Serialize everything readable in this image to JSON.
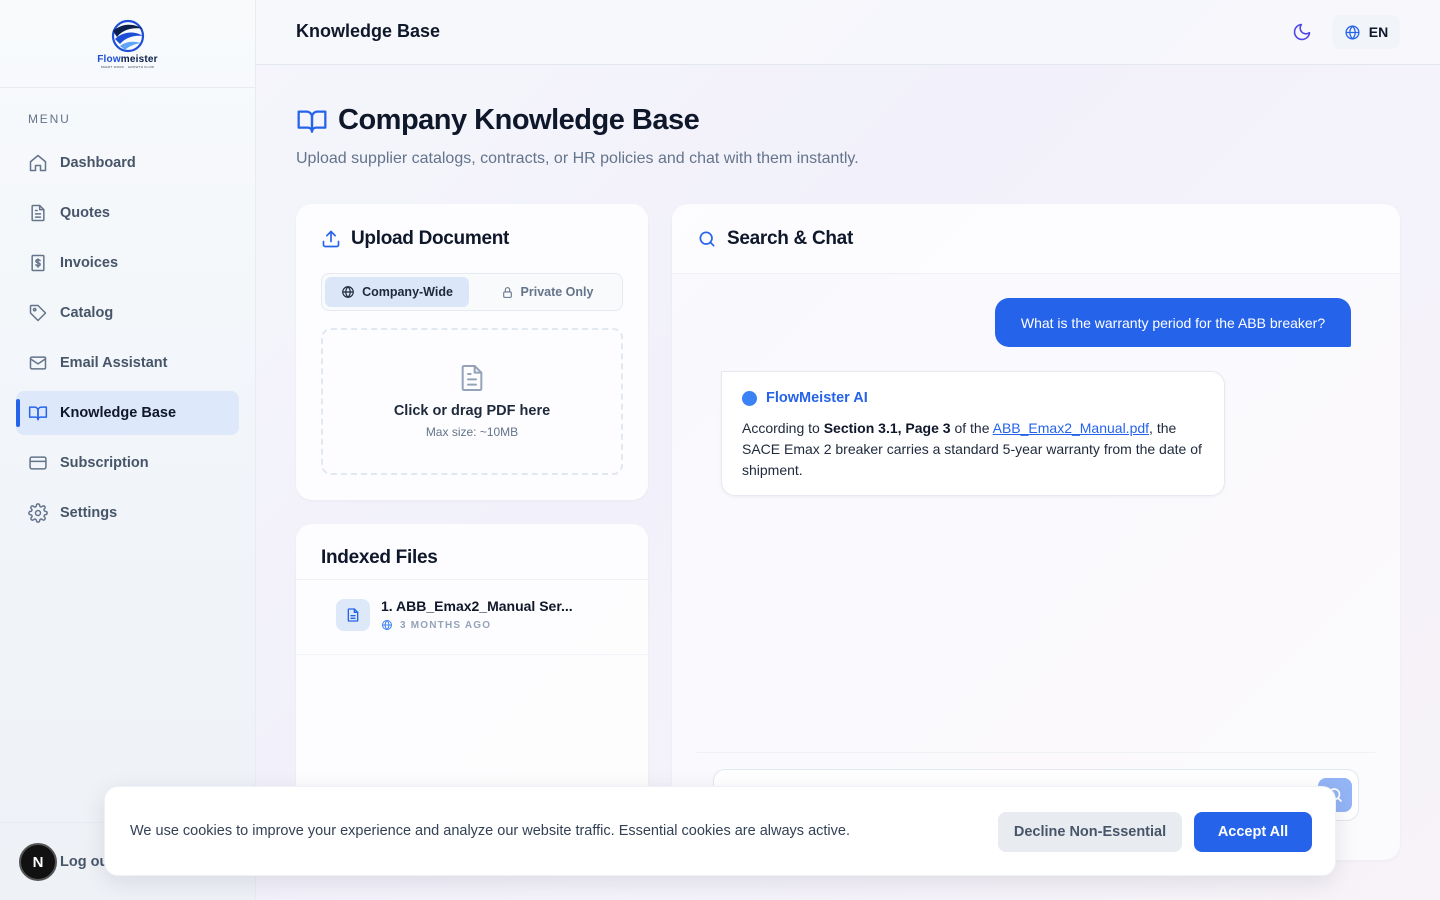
{
  "brand": {
    "name_part1": "Flow",
    "name_part2": "meister",
    "tagline": "SMART WORK · GROWTH FLOW"
  },
  "sidebar": {
    "menu_label": "MENU",
    "items": [
      {
        "label": "Dashboard",
        "icon": "home-icon"
      },
      {
        "label": "Quotes",
        "icon": "document-icon"
      },
      {
        "label": "Invoices",
        "icon": "dollar-file-icon"
      },
      {
        "label": "Catalog",
        "icon": "tag-icon"
      },
      {
        "label": "Email Assistant",
        "icon": "mail-icon"
      },
      {
        "label": "Knowledge Base",
        "icon": "book-icon",
        "active": true
      },
      {
        "label": "Subscription",
        "icon": "credit-card-icon"
      },
      {
        "label": "Settings",
        "icon": "gear-icon"
      }
    ],
    "avatar_letter": "N",
    "logout_label": "Log ou"
  },
  "header": {
    "title": "Knowledge Base",
    "language": "EN"
  },
  "page": {
    "title": "Company Knowledge Base",
    "subtitle": "Upload supplier catalogs, contracts, or HR policies and chat with them instantly."
  },
  "upload": {
    "title": "Upload Document",
    "scope_company": "Company-Wide",
    "scope_private": "Private Only",
    "drop_title": "Click or drag PDF here",
    "drop_sub": "Max size: ~10MB"
  },
  "files": {
    "title": "Indexed Files",
    "items": [
      {
        "name": "1. ABB_Emax2_Manual Ser...",
        "age": "3 MONTHS AGO"
      }
    ]
  },
  "chat": {
    "title": "Search & Chat",
    "user_message": "What is the warranty period for the ABB breaker?",
    "ai_name": "FlowMeister AI",
    "ai_text_1": "According to ",
    "ai_bold": "Section 3.1, Page 3",
    "ai_text_2": " of the ",
    "ai_link": "ABB_Emax2_Manual.pdf",
    "ai_text_3": ", the SACE Emax 2 breaker carries a standard 5-year warranty from the date of shipment."
  },
  "cookie": {
    "text": "We use cookies to improve your experience and analyze our website traffic. Essential cookies are always active.",
    "decline_label": "Decline Non-Essential",
    "accept_label": "Accept All"
  },
  "colors": {
    "accent": "#2563eb",
    "active_nav_bg": "#dde9fb"
  }
}
